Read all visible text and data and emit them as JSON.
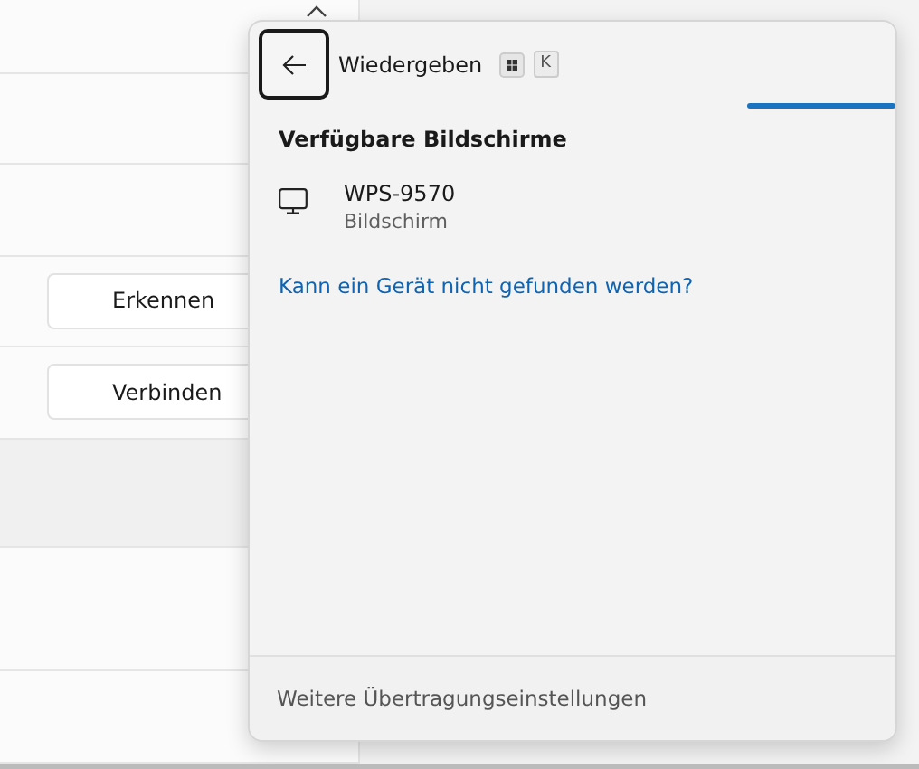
{
  "settings": {
    "actions": [
      {
        "label": "Erkennen"
      },
      {
        "label": "Verbinden"
      }
    ]
  },
  "flyout": {
    "title": "Wiedergeben",
    "shortcut_key": "K",
    "section_title": "Verfügbare Bildschirme",
    "devices": [
      {
        "name": "WPS-9570",
        "type": "Bildschirm"
      }
    ],
    "help_link": "Kann ein Gerät nicht gefunden werden?",
    "footer_link": "Weitere Übertragungseinstellungen"
  }
}
